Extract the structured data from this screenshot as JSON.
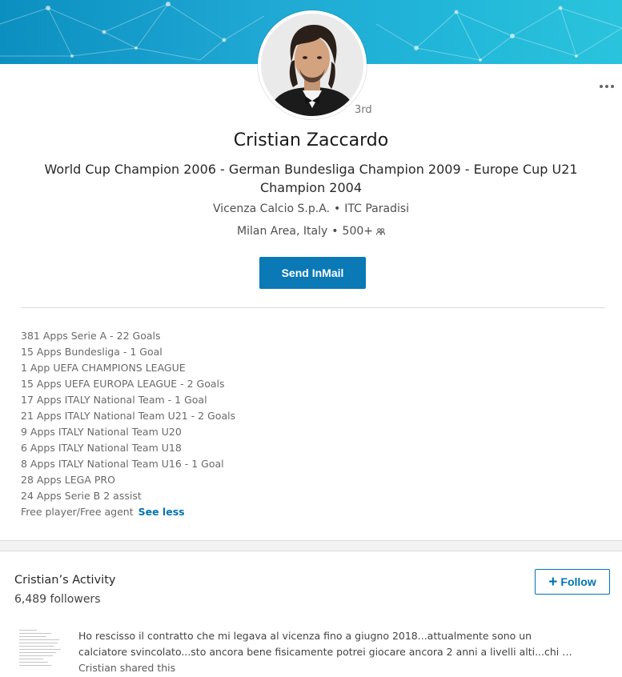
{
  "profile": {
    "name": "Cristian Zaccardo",
    "degree": "3rd",
    "headline": "World Cup Champion 2006 - German Bundesliga Champion 2009 - Europe Cup U21 Champion 2004",
    "company": "Vicenza Calcio S.p.A.",
    "education": "ITC Paradisi",
    "location": "Milan Area, Italy",
    "connections": "500+",
    "inmail_label": "Send InMail",
    "separator": "•"
  },
  "summary": {
    "lines": [
      "381 Apps Serie A - 22 Goals",
      "15 Apps Bundesliga - 1 Goal",
      "1 App UEFA CHAMPIONS LEAGUE",
      "15 Apps UEFA EUROPA LEAGUE - 2 Goals",
      "17 Apps ITALY National Team - 1 Goal",
      "21 Apps ITALY National Team U21 - 2 Goals",
      "9 Apps ITALY National Team U20",
      "6 Apps ITALY National Team U18",
      "8 Apps ITALY National Team U16 - 1 Goal",
      "28 Apps LEGA PRO",
      "24 Apps Serie B 2 assist",
      "Free player/Free agent"
    ],
    "see_less": "See less"
  },
  "activity": {
    "title": "Cristian’s Activity",
    "followers": "6,489 followers",
    "follow_label": "Follow",
    "post_line1": "Ho rescisso il contratto che mi legava al vicenza fino a giugno 2018...attualmente sono un",
    "post_line2": "calciatore svincolato...sto ancora bene fisicamente potrei giocare ancora 2 anni a livelli alti...chi …",
    "post_shared": "Cristian shared this"
  },
  "icons": {
    "more": "more-horizontal-icon",
    "connections": "people-icon",
    "follow": "plus-icon"
  },
  "colors": {
    "brand_blue": "#0073b1",
    "button_blue": "#0a79b6",
    "banner": "#1fa7d3"
  }
}
